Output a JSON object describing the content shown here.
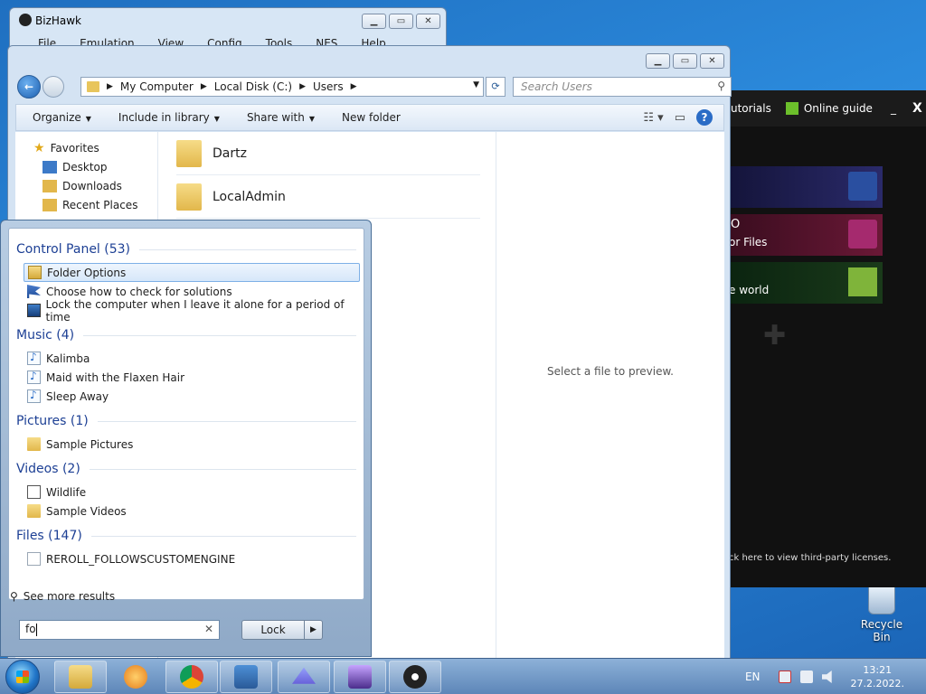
{
  "bizhawk": {
    "title": "BizHawk",
    "menu": [
      "File",
      "Emulation",
      "View",
      "Config",
      "Tools",
      "NES",
      "Help"
    ]
  },
  "dark_app": {
    "tutorials": "utorials",
    "online_guide": "Online guide",
    "minimize": "_",
    "close": "X",
    "tile1_text": "",
    "tile2_text": "O\nor Files",
    "tile2_line1": "O",
    "tile2_line2": "or Files",
    "tile3_text": "e world",
    "license_text": "ck here to view third-party licenses."
  },
  "explorer": {
    "breadcrumb": [
      "My Computer",
      "Local Disk (C:)",
      "Users"
    ],
    "search_placeholder": "Search Users",
    "commands": [
      "Organize",
      "Include in library",
      "Share with",
      "New folder"
    ],
    "nav": {
      "favorites": "Favorites",
      "items": [
        "Desktop",
        "Downloads",
        "Recent Places"
      ]
    },
    "files": [
      "Dartz",
      "LocalAdmin"
    ],
    "preview_text": "Select a file to preview."
  },
  "start_menu": {
    "groups": [
      {
        "title": "Control Panel (53)",
        "items": [
          {
            "label": "Folder Options",
            "icon": "folder-options-icon",
            "selected": true
          },
          {
            "label": "Choose how to check for solutions",
            "icon": "flag-icon"
          },
          {
            "label": "Lock the computer when I leave it alone for a period of time",
            "icon": "monitor-icon"
          }
        ]
      },
      {
        "title": "Music (4)",
        "items": [
          {
            "label": "Kalimba",
            "icon": "music-icon"
          },
          {
            "label": "Maid with the Flaxen Hair",
            "icon": "music-icon"
          },
          {
            "label": "Sleep Away",
            "icon": "music-icon"
          }
        ]
      },
      {
        "title": "Pictures (1)",
        "items": [
          {
            "label": "Sample Pictures",
            "icon": "folder-icon"
          }
        ]
      },
      {
        "title": "Videos (2)",
        "items": [
          {
            "label": "Wildlife",
            "icon": "video-icon"
          },
          {
            "label": "Sample Videos",
            "icon": "folder-icon"
          }
        ]
      },
      {
        "title": "Files (147)",
        "items": [
          {
            "label": "REROLL_FOLLOWSCUSTOMENGINE",
            "icon": "file-icon"
          }
        ]
      }
    ],
    "see_more": "See more results",
    "search_value": "fo",
    "lock_label": "Lock"
  },
  "desktop": {
    "recycle_bin": "Recycle Bin"
  },
  "taskbar": {
    "language": "EN",
    "time": "13:21",
    "date": "27.2.2022."
  }
}
